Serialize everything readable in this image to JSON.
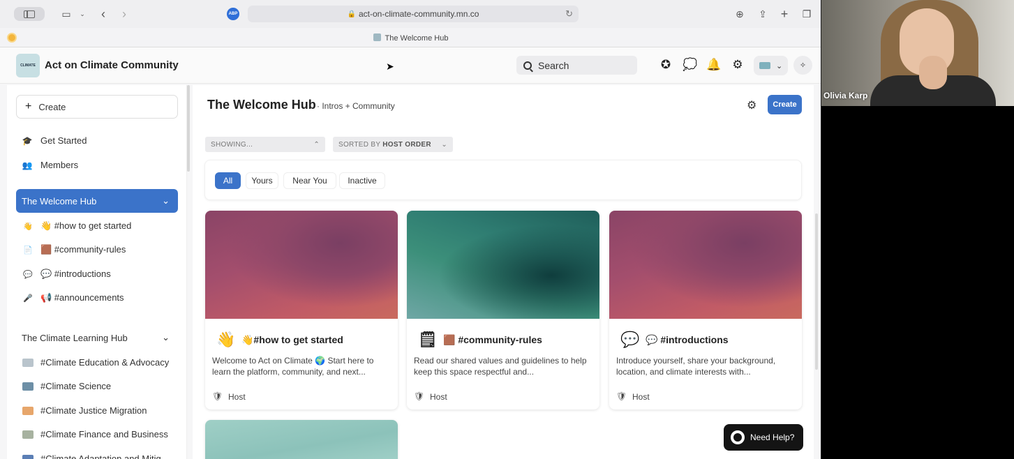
{
  "browser": {
    "url": "act-on-climate-community.mn.co",
    "tab_title": "The Welcome Hub",
    "abp_label": "ABP"
  },
  "header": {
    "app_name": "Act on Climate Community",
    "logo_text": "CLIMATE",
    "search_placeholder": "Search"
  },
  "sidebar": {
    "create_label": "Create",
    "nav": [
      {
        "label": "Get Started",
        "icon": "graduation-cap-icon"
      },
      {
        "label": "Members",
        "icon": "people-icon"
      }
    ],
    "welcome_hub": {
      "label": "The Welcome Hub",
      "channels": [
        {
          "label": "👋 #how to get started",
          "icon": "👋"
        },
        {
          "label": "🟫 #community-rules",
          "icon": "📄"
        },
        {
          "label": "💬 #introductions",
          "icon": "💬"
        },
        {
          "label": "📢 #announcements",
          "icon": "🎤"
        }
      ]
    },
    "learning_hub": {
      "label": "The Climate Learning Hub",
      "channels": [
        {
          "label": "#Climate Education & Advocacy",
          "color": "#b9c4cc"
        },
        {
          "label": "#Climate Science",
          "color": "#6d8fa6"
        },
        {
          "label": "#Climate Justice Migration",
          "color": "#e7a66b"
        },
        {
          "label": "#Climate Finance and Business",
          "color": "#a7b2a0"
        },
        {
          "label": "#Climate Adaptation and Mitig",
          "color": "#5b7fb5"
        }
      ]
    }
  },
  "main": {
    "title": "The Welcome Hub",
    "subtitle": "· Intros + Community",
    "create_label": "Create",
    "showing_label": "SHOWING...",
    "sorted_prefix": "SORTED BY ",
    "sorted_value": "HOST ORDER",
    "filters": [
      "All",
      "Yours",
      "Near You",
      "Inactive"
    ],
    "active_filter": "All",
    "cards": [
      {
        "icon": "👋",
        "title": "👋#how to get started",
        "description": "Welcome to Act on Climate 🌍 Start here to learn the platform, community, and next...",
        "host_label": "Host"
      },
      {
        "icon": "🗒",
        "title": "🟫 #community-rules",
        "description": "Read our shared values and guidelines to help keep this space respectful and...",
        "host_label": "Host"
      },
      {
        "icon": "💬",
        "title": "💬 #introductions",
        "description": "Introduce yourself, share your background, location, and climate interests with...",
        "host_label": "Host"
      }
    ],
    "help_label": "Need Help?"
  },
  "video": {
    "participant_name": "Olivia Karp"
  },
  "colors": {
    "accent": "#3b73c9",
    "help_bg": "#141414"
  }
}
